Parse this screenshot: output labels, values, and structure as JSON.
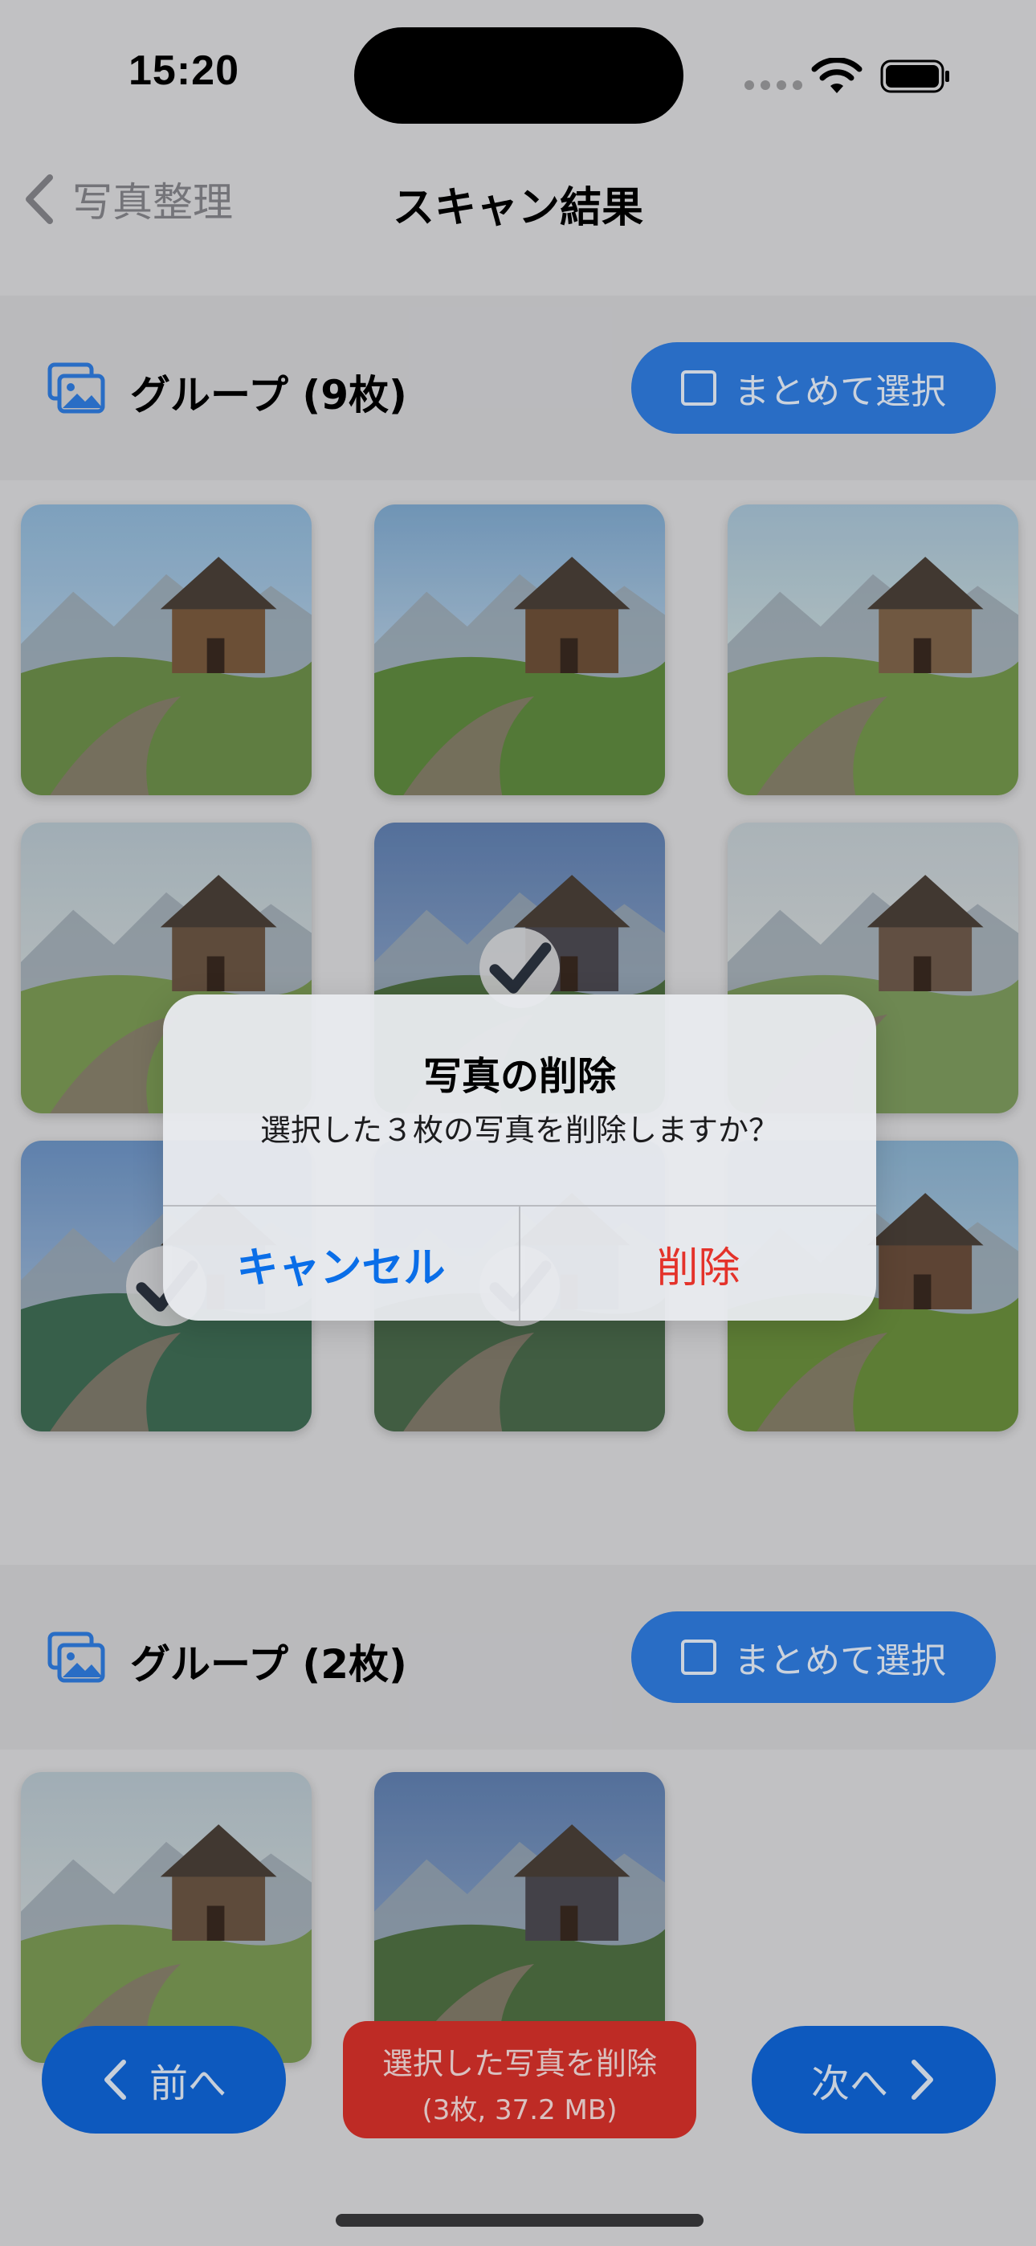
{
  "status_bar": {
    "time": "15:20"
  },
  "nav": {
    "back_label": "写真整理",
    "title": "スキャン結果"
  },
  "groups": [
    {
      "title": "グループ (9枚)",
      "select_all_label": "まとめて選択",
      "photo_count": 9,
      "checked_photos": [
        5,
        7,
        8
      ]
    },
    {
      "title": "グループ (2枚)",
      "select_all_label": "まとめて選択",
      "photo_count": 2,
      "checked_photos": []
    }
  ],
  "toolbar": {
    "prev_label": "前へ",
    "delete_label": "選択した写真を削除",
    "delete_detail": "(3枚, 37.2 MB)",
    "next_label": "次へ"
  },
  "alert": {
    "title": "写真の削除",
    "message": "選択した３枚の写真を削除しますか？",
    "cancel_label": "キャンセル",
    "delete_label": "削除"
  },
  "colors": {
    "accent": "#2f7de1",
    "nav_button": "#0f66d9",
    "danger": "#d9322b",
    "alert_cancel": "#0a6ee8",
    "alert_delete": "#e4322a"
  }
}
